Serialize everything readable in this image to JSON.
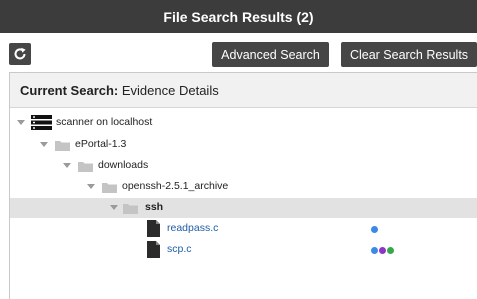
{
  "window": {
    "title": "File Search Results (2)"
  },
  "toolbar": {
    "refresh_icon": "refresh-icon",
    "advanced_search_label": "Advanced Search",
    "clear_search_label": "Clear Search Results"
  },
  "panel": {
    "current_search_label": "Current Search:",
    "current_search_value": "Evidence Details"
  },
  "tree": {
    "scanner": "scanner on localhost",
    "eportal": "ePortal-1.3",
    "downloads": "downloads",
    "archive": "openssh-2.5.1_archive",
    "ssh": "ssh",
    "files": [
      {
        "name": "readpass.c",
        "dots": [
          "#3a8ae6"
        ]
      },
      {
        "name": "scp.c",
        "dots": [
          "#3a8ae6",
          "#8e35c9",
          "#37a84a"
        ]
      }
    ]
  }
}
